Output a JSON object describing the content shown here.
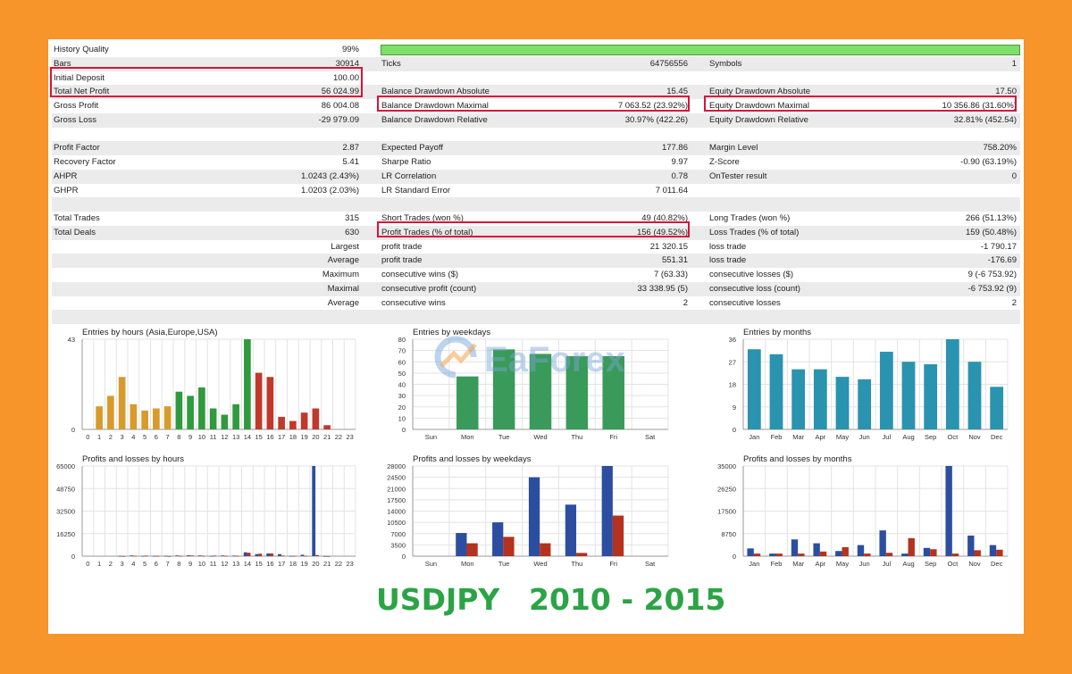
{
  "report": {
    "rows": [
      {
        "alt": false,
        "c1": [
          "History Quality",
          "99%"
        ],
        "c2": null,
        "c3": null,
        "quality_bar": 0.99
      },
      {
        "alt": true,
        "c1": [
          "Bars",
          "30914"
        ],
        "c2": [
          "Ticks",
          "64756556"
        ],
        "c3": [
          "Symbols",
          "1"
        ]
      },
      {
        "alt": false,
        "c1": [
          "Initial Deposit",
          "100.00"
        ],
        "c2": null,
        "c3": null
      },
      {
        "alt": true,
        "c1": [
          "Total Net Profit",
          "56 024.99"
        ],
        "c2": [
          "Balance Drawdown Absolute",
          "15.45"
        ],
        "c3": [
          "Equity Drawdown Absolute",
          "17.50"
        ]
      },
      {
        "alt": false,
        "c1": [
          "Gross Profit",
          "86 004.08"
        ],
        "c2": [
          "Balance Drawdown Maximal",
          "7 063.52 (23.92%)"
        ],
        "c3": [
          "Equity Drawdown Maximal",
          "10 356.86 (31.60%)"
        ]
      },
      {
        "alt": true,
        "c1": [
          "Gross Loss",
          "-29 979.09"
        ],
        "c2": [
          "Balance Drawdown Relative",
          "30.97% (422.26)"
        ],
        "c3": [
          "Equity Drawdown Relative",
          "32.81% (452.54)"
        ]
      },
      {
        "alt": false,
        "c1": null,
        "c2": null,
        "c3": null
      },
      {
        "alt": true,
        "c1": [
          "Profit Factor",
          "2.87"
        ],
        "c2": [
          "Expected Payoff",
          "177.86"
        ],
        "c3": [
          "Margin Level",
          "758.20%"
        ]
      },
      {
        "alt": false,
        "c1": [
          "Recovery Factor",
          "5.41"
        ],
        "c2": [
          "Sharpe Ratio",
          "9.97"
        ],
        "c3": [
          "Z-Score",
          "-0.90 (63.19%)"
        ]
      },
      {
        "alt": true,
        "c1": [
          "AHPR",
          "1.0243 (2.43%)"
        ],
        "c2": [
          "LR Correlation",
          "0.78"
        ],
        "c3": [
          "OnTester result",
          "0"
        ]
      },
      {
        "alt": false,
        "c1": [
          "GHPR",
          "1.0203 (2.03%)"
        ],
        "c2": [
          "LR Standard Error",
          "7 011.64"
        ],
        "c3": null
      },
      {
        "alt": true,
        "c1": null,
        "c2": null,
        "c3": null
      },
      {
        "alt": false,
        "c1": [
          "Total Trades",
          "315"
        ],
        "c2": [
          "Short Trades (won %)",
          "49 (40.82%)"
        ],
        "c3": [
          "Long Trades (won %)",
          "266 (51.13%)"
        ]
      },
      {
        "alt": true,
        "c1": [
          "Total Deals",
          "630"
        ],
        "c2": [
          "Profit Trades (% of total)",
          "156 (49.52%)"
        ],
        "c3": [
          "Loss Trades (% of total)",
          "159 (50.48%)"
        ]
      },
      {
        "alt": false,
        "c1": [
          "",
          "Largest"
        ],
        "c2": [
          "profit trade",
          "21 320.15"
        ],
        "c3": [
          "loss trade",
          "-1 790.17"
        ]
      },
      {
        "alt": true,
        "c1": [
          "",
          "Average"
        ],
        "c2": [
          "profit trade",
          "551.31"
        ],
        "c3": [
          "loss trade",
          "-176.69"
        ]
      },
      {
        "alt": false,
        "c1": [
          "",
          "Maximum"
        ],
        "c2": [
          "consecutive wins ($)",
          "7 (63.33)"
        ],
        "c3": [
          "consecutive losses ($)",
          "9 (-6 753.92)"
        ]
      },
      {
        "alt": true,
        "c1": [
          "",
          "Maximal"
        ],
        "c2": [
          "consecutive profit (count)",
          "33 338.95 (5)"
        ],
        "c3": [
          "consecutive loss (count)",
          "-6 753.92 (9)"
        ]
      },
      {
        "alt": false,
        "c1": [
          "",
          "Average"
        ],
        "c2": [
          "consecutive wins",
          "2"
        ],
        "c3": [
          "consecutive losses",
          "2"
        ]
      },
      {
        "alt": true,
        "c1": null,
        "c2": null,
        "c3": null
      }
    ]
  },
  "colors": {
    "highlight": "#d8143a",
    "profit": "#2c4ea0",
    "loss": "#b5321e",
    "footer_text": "#2ba445",
    "background": "#f7942a"
  },
  "watermark": "EaForex",
  "footer": {
    "symbol": "USDJPY",
    "period": "2010 - 2015"
  },
  "chart_data": [
    {
      "type": "bar",
      "title": "Entries by hours (Asia,Europe,USA)",
      "categories": [
        "0",
        "1",
        "2",
        "3",
        "4",
        "5",
        "6",
        "7",
        "8",
        "9",
        "10",
        "11",
        "12",
        "13",
        "14",
        "15",
        "16",
        "17",
        "18",
        "19",
        "20",
        "21",
        "22",
        "23"
      ],
      "values": [
        0,
        11,
        16,
        25,
        12,
        9,
        10,
        11,
        18,
        16,
        20,
        10,
        7,
        12,
        43,
        27,
        25,
        6,
        4,
        8,
        10,
        2,
        0,
        0
      ],
      "bar_colors": [
        "#d89a2a",
        "#d89a2a",
        "#d89a2a",
        "#d89a2a",
        "#d89a2a",
        "#d89a2a",
        "#d89a2a",
        "#d89a2a",
        "#2f9a3e",
        "#2f9a3e",
        "#2f9a3e",
        "#2f9a3e",
        "#2f9a3e",
        "#2f9a3e",
        "#2f9a3e",
        "#c0392b",
        "#c0392b",
        "#c0392b",
        "#c0392b",
        "#c0392b",
        "#c0392b",
        "#c0392b",
        "#c0392b",
        "#c0392b"
      ],
      "ylim": [
        0,
        43
      ],
      "yticks": [
        "43",
        "0"
      ]
    },
    {
      "type": "bar",
      "title": "Entries by weekdays",
      "categories": [
        "Sun",
        "Mon",
        "Tue",
        "Wed",
        "Thu",
        "Fri",
        "Sat"
      ],
      "values": [
        0,
        47,
        71,
        67,
        65,
        65,
        0
      ],
      "color": "#3a9a5a",
      "ylim": [
        0,
        80
      ],
      "yticks": [
        "80",
        "70",
        "60",
        "50",
        "40",
        "30",
        "20",
        "10",
        "0"
      ]
    },
    {
      "type": "bar",
      "title": "Entries by months",
      "categories": [
        "Jan",
        "Feb",
        "Mar",
        "Apr",
        "May",
        "Jun",
        "Jul",
        "Aug",
        "Sep",
        "Oct",
        "Nov",
        "Dec"
      ],
      "values": [
        32,
        30,
        24,
        24,
        21,
        20,
        31,
        27,
        26,
        36,
        27,
        17
      ],
      "color": "#2a93b0",
      "ylim": [
        0,
        36
      ],
      "yticks": [
        "36",
        "27",
        "18",
        "9",
        "0"
      ]
    },
    {
      "type": "bar",
      "title": "Profits and losses by hours",
      "categories": [
        "0",
        "1",
        "2",
        "3",
        "4",
        "5",
        "6",
        "7",
        "8",
        "9",
        "10",
        "11",
        "12",
        "13",
        "14",
        "15",
        "16",
        "17",
        "18",
        "19",
        "20",
        "21",
        "22",
        "23"
      ],
      "series": [
        {
          "values": [
            0,
            0,
            0,
            200,
            500,
            200,
            200,
            300,
            500,
            600,
            500,
            200,
            500,
            400,
            2800,
            1500,
            2000,
            1500,
            200,
            1000,
            65000,
            100,
            0,
            0
          ]
        },
        {
          "values": [
            0,
            0,
            0,
            100,
            300,
            400,
            200,
            100,
            300,
            500,
            300,
            400,
            300,
            200,
            2500,
            1800,
            2000,
            400,
            200,
            300,
            800,
            100,
            0,
            0
          ]
        }
      ],
      "ylim": [
        0,
        65000
      ],
      "yticks": [
        "65000",
        "48750",
        "32500",
        "16250",
        "0"
      ]
    },
    {
      "type": "bar",
      "title": "Profits and losses by weekdays",
      "categories": [
        "Sun",
        "Mon",
        "Tue",
        "Wed",
        "Thu",
        "Fri",
        "Sat"
      ],
      "series": [
        {
          "values": [
            0,
            7200,
            10500,
            24500,
            16000,
            28000,
            0
          ]
        },
        {
          "values": [
            0,
            4000,
            6000,
            4000,
            1000,
            12600,
            0
          ]
        }
      ],
      "ylim": [
        0,
        28000
      ],
      "yticks": [
        "28000",
        "24500",
        "21000",
        "17500",
        "14000",
        "10500",
        "7000",
        "3500",
        "0"
      ]
    },
    {
      "type": "bar",
      "title": "Profits and losses by months",
      "categories": [
        "Jan",
        "Feb",
        "Mar",
        "Apr",
        "May",
        "Jun",
        "Jul",
        "Aug",
        "Sep",
        "Oct",
        "Nov",
        "Dec"
      ],
      "series": [
        {
          "values": [
            3000,
            1000,
            6500,
            5000,
            2000,
            4300,
            10000,
            1000,
            3200,
            35000,
            8000,
            4300
          ]
        },
        {
          "values": [
            1000,
            1000,
            1000,
            1800,
            3500,
            1000,
            1300,
            7000,
            2700,
            1000,
            2300,
            2500
          ]
        }
      ],
      "ylim": [
        0,
        35000
      ],
      "yticks": [
        "35000",
        "26250",
        "17500",
        "8750",
        "0"
      ]
    }
  ]
}
